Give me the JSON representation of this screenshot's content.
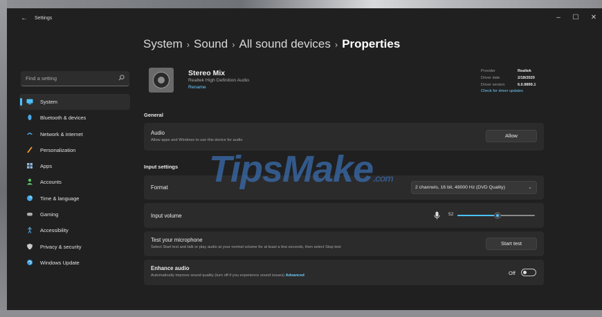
{
  "window": {
    "title": "Settings",
    "back_glyph": "←",
    "controls": {
      "minimize": "–",
      "maximize": "☐",
      "close": "✕"
    }
  },
  "sidebar": {
    "search_placeholder": "Find a setting",
    "items": [
      {
        "label": "System",
        "icon": "system-icon",
        "active": true
      },
      {
        "label": "Bluetooth & devices",
        "icon": "bluetooth-icon"
      },
      {
        "label": "Network & internet",
        "icon": "network-icon"
      },
      {
        "label": "Personalization",
        "icon": "personalization-icon"
      },
      {
        "label": "Apps",
        "icon": "apps-icon"
      },
      {
        "label": "Accounts",
        "icon": "accounts-icon"
      },
      {
        "label": "Time & language",
        "icon": "time-language-icon"
      },
      {
        "label": "Gaming",
        "icon": "gaming-icon"
      },
      {
        "label": "Accessibility",
        "icon": "accessibility-icon"
      },
      {
        "label": "Privacy & security",
        "icon": "privacy-icon"
      },
      {
        "label": "Windows Update",
        "icon": "windows-update-icon"
      }
    ]
  },
  "breadcrumb": {
    "items": [
      "System",
      "Sound",
      "All sound devices"
    ],
    "current": "Properties",
    "separator": "›"
  },
  "device": {
    "name": "Stereo Mix",
    "subtitle": "Realtek High Definition Audio",
    "rename": "Rename",
    "driver": {
      "provider_label": "Provider",
      "provider": "Realtek",
      "date_label": "Driver date",
      "date": "2/18/2020",
      "version_label": "Driver version",
      "version": "6.0.8899.1",
      "update_link": "Check for driver updates"
    }
  },
  "general": {
    "section_title": "General",
    "audio": {
      "title": "Audio",
      "description": "Allow apps and Windows to use this device for audio",
      "button": "Allow"
    }
  },
  "input_settings": {
    "section_title": "Input settings",
    "format": {
      "label": "Format",
      "value": "2 channels, 16 bit, 48000 Hz (DVD Quality)",
      "chevron": "⌄"
    },
    "input_volume": {
      "label": "Input volume",
      "value": "52",
      "level": 0.52
    },
    "test_mic": {
      "title": "Test your microphone",
      "description": "Select Start test and talk or play audio at your normal volume for at least a few seconds, then select Stop test",
      "button": "Start test"
    },
    "enhance": {
      "title": "Enhance audio",
      "description": "Automatically improve sound quality (turn off if you experience sound issues)",
      "link": "Advanced",
      "toggle_label": "Off",
      "on": false
    }
  },
  "watermark": {
    "text": "TipsMake",
    "suffix": ".com"
  },
  "colors": {
    "accent": "#4cc2ff",
    "window_bg": "#202020",
    "card_bg": "#2b2b2b",
    "watermark": "#3b6fb3"
  }
}
